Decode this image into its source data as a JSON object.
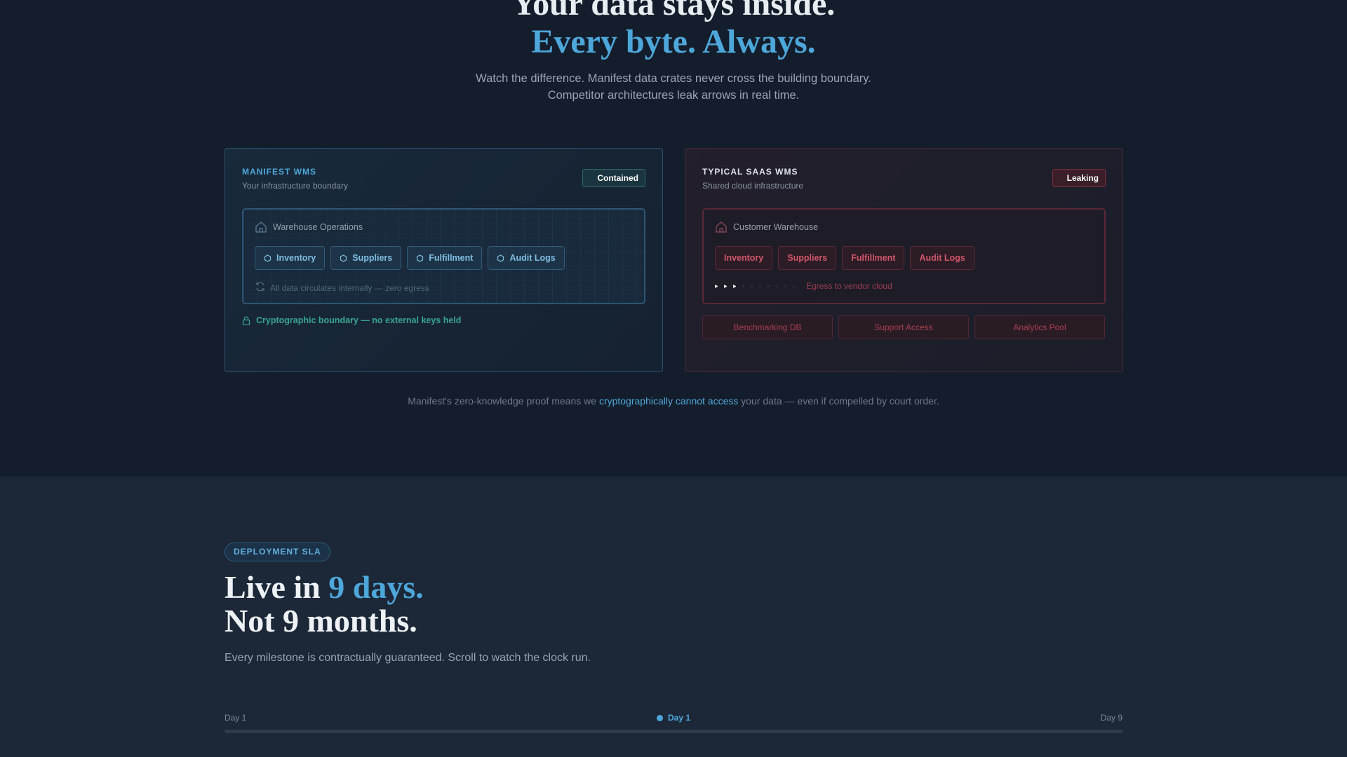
{
  "hero": {
    "line1": "Your data stays inside.",
    "line2": "Every byte. Always.",
    "sub_line1": "Watch the difference. Manifest data crates never cross the building boundary.",
    "sub_line2": "Competitor architectures leak arrows in real time."
  },
  "manifest_card": {
    "title": "MANIFEST WMS",
    "subtitle": "Your infrastructure boundary",
    "status": "Contained",
    "box_title": "Warehouse Operations",
    "modules": [
      "Inventory",
      "Suppliers",
      "Fulfillment",
      "Audit Logs"
    ],
    "box_note": "All data circulates internally — zero egress",
    "boundary_note": "Cryptographic boundary — no external keys held"
  },
  "saas_card": {
    "title": "TYPICAL SAAS WMS",
    "subtitle": "Shared cloud infrastructure",
    "status": "Leaking",
    "box_title": "Customer Warehouse",
    "modules": [
      "Inventory",
      "Suppliers",
      "Fulfillment",
      "Audit Logs"
    ],
    "box_note": "Egress to vendor cloud",
    "leak_targets": [
      "Benchmarking DB",
      "Support Access",
      "Analytics Pool"
    ]
  },
  "footnote": {
    "before": "Manifest's zero-knowledge proof means we ",
    "highlight": "cryptographically cannot access",
    "after": " your data — even if compelled by court order."
  },
  "sla": {
    "badge": "DEPLOYMENT SLA",
    "head_pre": "Live in ",
    "head_accent": "9 days.",
    "head_line2": "Not 9 months.",
    "sub": "Every milestone is contractually guaranteed. Scroll to watch the clock run.",
    "timeline": {
      "start_label": "Day 1",
      "current_label": "Day 1",
      "end_label": "Day 9",
      "progress_fraction": 0
    }
  },
  "colors": {
    "accent": "#4ea7da",
    "contained": "#38a58e",
    "leak": "#d0566a"
  },
  "icons": {
    "warehouse": "house-icon",
    "module": "hexagon-icon",
    "circulate": "refresh-icon",
    "boundary": "lock-icon"
  }
}
